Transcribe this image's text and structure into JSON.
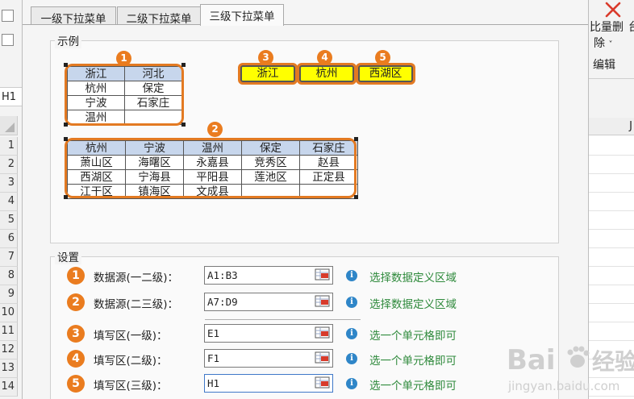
{
  "tabs": [
    {
      "label": "一级下拉菜单"
    },
    {
      "label": "二级下拉菜单"
    },
    {
      "label": "三级下拉菜单"
    }
  ],
  "sample": {
    "legend": "示例",
    "table1": {
      "header": [
        "浙江",
        "河北"
      ],
      "rows": [
        [
          "杭州",
          "保定"
        ],
        [
          "宁波",
          "石家庄"
        ],
        [
          "温州",
          ""
        ]
      ]
    },
    "table2": {
      "header": [
        "杭州",
        "宁波",
        "温州",
        "保定",
        "石家庄"
      ],
      "rows": [
        [
          "萧山区",
          "海曙区",
          "永嘉县",
          "竞秀区",
          "赵县"
        ],
        [
          "西湖区",
          "宁海县",
          "平阳县",
          "莲池区",
          "正定县"
        ],
        [
          "江干区",
          "镇海区",
          "文成县",
          "",
          ""
        ]
      ]
    },
    "fill_cells": [
      "浙江",
      "杭州",
      "西湖区"
    ],
    "badges": [
      "1",
      "2",
      "3",
      "4",
      "5"
    ]
  },
  "settings": {
    "legend": "设置",
    "rows": [
      {
        "num": "1",
        "label": "数据源(一二级)：",
        "value": "A1:B3",
        "hint": "选择数据定义区域"
      },
      {
        "num": "2",
        "label": "数据源(二三级)：",
        "value": "A7:D9",
        "hint": "选择数据定义区域"
      },
      {
        "num": "3",
        "label": "填写区(一级)：",
        "value": "E1",
        "hint": "选一个单元格即可"
      },
      {
        "num": "4",
        "label": "填写区(二级)：",
        "value": "F1",
        "hint": "选一个单元格即可"
      },
      {
        "num": "5",
        "label": "填写区(三级)：",
        "value": "H1",
        "hint": "选一个单元格即可"
      }
    ],
    "info_glyph": "i"
  },
  "background": {
    "namebox": "H1",
    "row_numbers": [
      "1",
      "2",
      "3",
      "4",
      "5",
      "6",
      "7",
      "8",
      "9",
      "10",
      "11",
      "12",
      "13",
      "14"
    ],
    "col_header": "J",
    "ribbon": {
      "batch_delete": "比量删",
      "delete_suffix": "除",
      "delete_arrow": "˅",
      "edit_group": "编辑",
      "extra": "台"
    }
  },
  "watermark": {
    "brand": "Bai",
    "brand_suffix": "经验",
    "url": "jingyan.baidu.com"
  },
  "colors": {
    "accent_orange": "#ea7c1f",
    "header_blue": "#c7d6ec",
    "fill_yellow": "#ffff00",
    "hint_green": "#2f8a3c",
    "info_blue": "#2f86c8"
  }
}
